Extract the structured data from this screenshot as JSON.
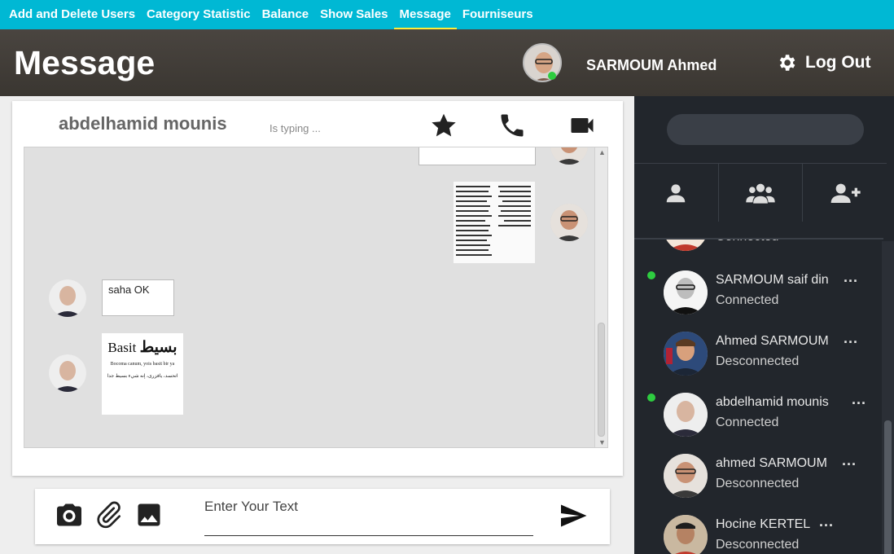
{
  "nav": {
    "items": [
      {
        "label": "Add and Delete Users",
        "active": false
      },
      {
        "label": "Category Statistic",
        "active": false
      },
      {
        "label": "Balance",
        "active": false
      },
      {
        "label": "Show Sales",
        "active": false
      },
      {
        "label": "Message",
        "active": true
      },
      {
        "label": "Fourniseurs",
        "active": false
      }
    ]
  },
  "header": {
    "title": "Message",
    "user_name": "SARMOUM Ahmed",
    "logout_label": "Log Out"
  },
  "chat": {
    "contact_name": "abdelhamid mounis",
    "typing_status": "Is typing ...",
    "messages": [
      {
        "side": "right",
        "type": "text",
        "text": ""
      },
      {
        "side": "right",
        "type": "image",
        "text": ""
      },
      {
        "side": "left",
        "type": "text",
        "text": "saha OK"
      },
      {
        "side": "left",
        "type": "image",
        "text": ""
      }
    ],
    "image_message_texts": {
      "basit_title": "Basit",
      "basit_arabic": "بسيط",
      "basit_line1": "Bocoma canum, yois basit bir ya",
      "basit_line2": "اتحسد، يافزرى، إنه شيء بسيط جدا"
    }
  },
  "composer": {
    "placeholder": "Enter Your Text"
  },
  "sidebar": {
    "search_placeholder": "",
    "contacts": [
      {
        "name": "",
        "status": "Connected",
        "online": false
      },
      {
        "name": "SARMOUM saif din",
        "status": "Connected",
        "online": true
      },
      {
        "name": "Ahmed SARMOUM",
        "status": "Desconnected",
        "online": false
      },
      {
        "name": "abdelhamid mounis",
        "status": "Connected",
        "online": true
      },
      {
        "name": "ahmed SARMOUM",
        "status": "Desconnected",
        "online": false
      },
      {
        "name": "Hocine KERTEL",
        "status": "Desconnected",
        "online": false
      }
    ],
    "more_label": "..."
  },
  "colors": {
    "nav_bg": "#00b8d4",
    "active_underline": "#ffeb3b",
    "sidebar_bg": "#22262c",
    "online": "#2ecc40"
  }
}
